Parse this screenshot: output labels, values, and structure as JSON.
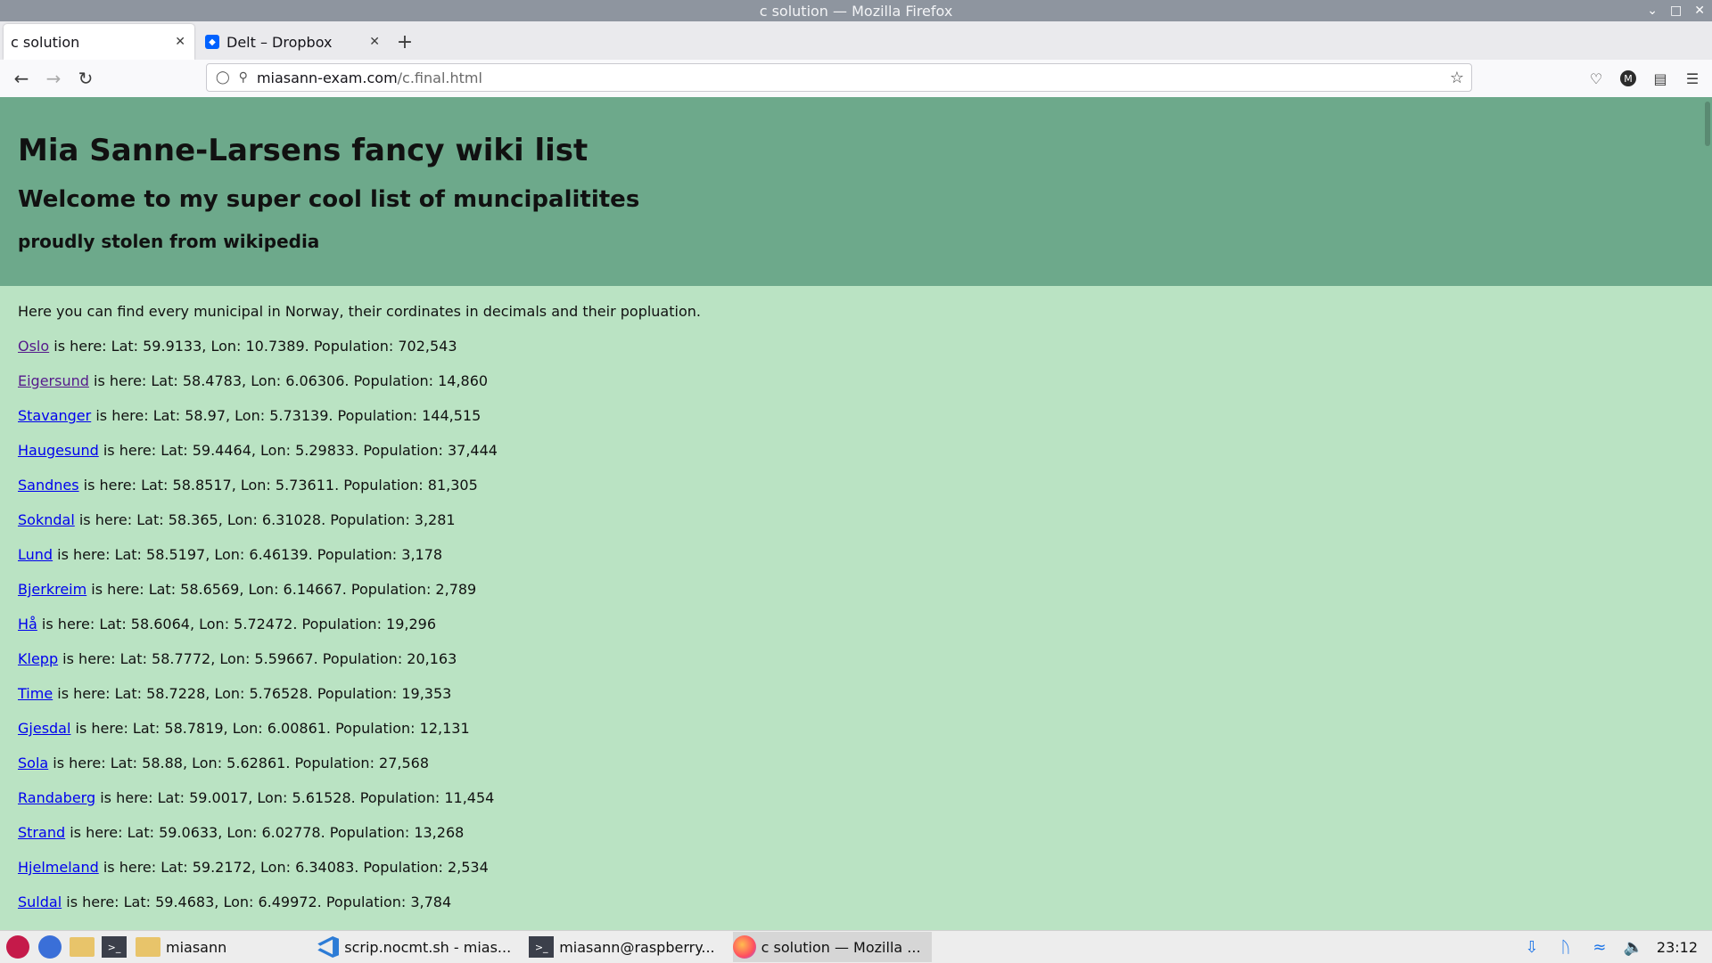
{
  "window": {
    "title": "c solution — Mozilla Firefox"
  },
  "tabs": [
    {
      "label": "c solution",
      "active": true
    },
    {
      "label": "Delt – Dropbox",
      "active": false
    }
  ],
  "url": {
    "host": "miasann-exam.com",
    "path": "/c.final.html"
  },
  "page": {
    "h1": "Mia Sanne-Larsens fancy wiki list",
    "h2": "Welcome to my super cool list of muncipalitites",
    "h3": "proudly stolen from wikipedia",
    "intro": "Here you can find every municipal in Norway, their cordinates in decimals and their popluation.",
    "entries": [
      {
        "name": "Oslo",
        "text": " is here: Lat: 59.9133, Lon: 10.7389. Population: 702,543"
      },
      {
        "name": "Eigersund",
        "text": " is here: Lat: 58.4783, Lon: 6.06306. Population: 14,860"
      },
      {
        "name": "Stavanger",
        "text": " is here: Lat: 58.97, Lon: 5.73139. Population: 144,515"
      },
      {
        "name": "Haugesund",
        "text": " is here: Lat: 59.4464, Lon: 5.29833. Population: 37,444"
      },
      {
        "name": "Sandnes",
        "text": " is here: Lat: 58.8517, Lon: 5.73611. Population: 81,305"
      },
      {
        "name": "Sokndal",
        "text": " is here: Lat: 58.365, Lon: 6.31028. Population: 3,281"
      },
      {
        "name": "Lund",
        "text": " is here: Lat: 58.5197, Lon: 6.46139. Population: 3,178"
      },
      {
        "name": "Bjerkreim",
        "text": " is here: Lat: 58.6569, Lon: 6.14667. Population: 2,789"
      },
      {
        "name": "Hå",
        "text": " is here: Lat: 58.6064, Lon: 5.72472. Population: 19,296"
      },
      {
        "name": "Klepp",
        "text": " is here: Lat: 58.7772, Lon: 5.59667. Population: 20,163"
      },
      {
        "name": "Time",
        "text": " is here: Lat: 58.7228, Lon: 5.76528. Population: 19,353"
      },
      {
        "name": "Gjesdal",
        "text": " is here: Lat: 58.7819, Lon: 6.00861. Population: 12,131"
      },
      {
        "name": "Sola",
        "text": " is here: Lat: 58.88, Lon: 5.62861. Population: 27,568"
      },
      {
        "name": "Randaberg",
        "text": " is here: Lat: 59.0017, Lon: 5.61528. Population: 11,454"
      },
      {
        "name": "Strand",
        "text": " is here: Lat: 59.0633, Lon: 6.02778. Population: 13,268"
      },
      {
        "name": "Hjelmeland",
        "text": " is here: Lat: 59.2172, Lon: 6.34083. Population: 2,534"
      },
      {
        "name": "Suldal",
        "text": " is here: Lat: 59.4683, Lon: 6.49972. Population: 3,784"
      }
    ]
  },
  "taskbar": {
    "folder_label": "miasann",
    "items": [
      {
        "label": "scrip.nocmt.sh - mias..."
      },
      {
        "label": "miasann@raspberry..."
      },
      {
        "label": "c solution — Mozilla ..."
      }
    ],
    "clock": "23:12"
  },
  "colors": {
    "header_bg": "#6da98b",
    "page_bg": "#bae3c3",
    "link": "#0000ee",
    "visited_link": "#551a8b"
  }
}
